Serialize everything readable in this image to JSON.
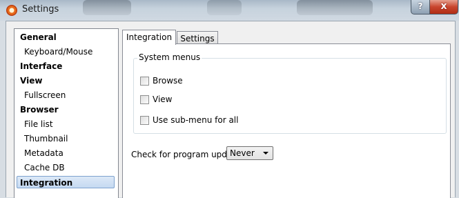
{
  "window": {
    "title": "Settings",
    "help_label": "?",
    "close_label": "x"
  },
  "sidebar": {
    "items": [
      {
        "label": "General",
        "type": "category"
      },
      {
        "label": "Keyboard/Mouse",
        "type": "sub"
      },
      {
        "label": "Interface",
        "type": "category"
      },
      {
        "label": "View",
        "type": "category"
      },
      {
        "label": "Fullscreen",
        "type": "sub"
      },
      {
        "label": "Browser",
        "type": "category"
      },
      {
        "label": "File list",
        "type": "sub"
      },
      {
        "label": "Thumbnail",
        "type": "sub"
      },
      {
        "label": "Metadata",
        "type": "sub"
      },
      {
        "label": "Cache DB",
        "type": "sub"
      },
      {
        "label": "Integration",
        "type": "category",
        "selected": true
      }
    ]
  },
  "tabs": [
    {
      "label": "Integration",
      "active": true
    },
    {
      "label": "Settings",
      "active": false
    }
  ],
  "system_menus": {
    "title": "System menus",
    "options": [
      {
        "label": "Browse",
        "checked": false
      },
      {
        "label": "View",
        "checked": false
      },
      {
        "label": "Use sub-menu for all",
        "checked": false
      }
    ]
  },
  "updates": {
    "label": "Check for program updates",
    "selected": "Never"
  },
  "colors": {
    "selection": "#c5d9f1",
    "selection_border": "#7da2ce",
    "close_button": "#c8452d"
  }
}
